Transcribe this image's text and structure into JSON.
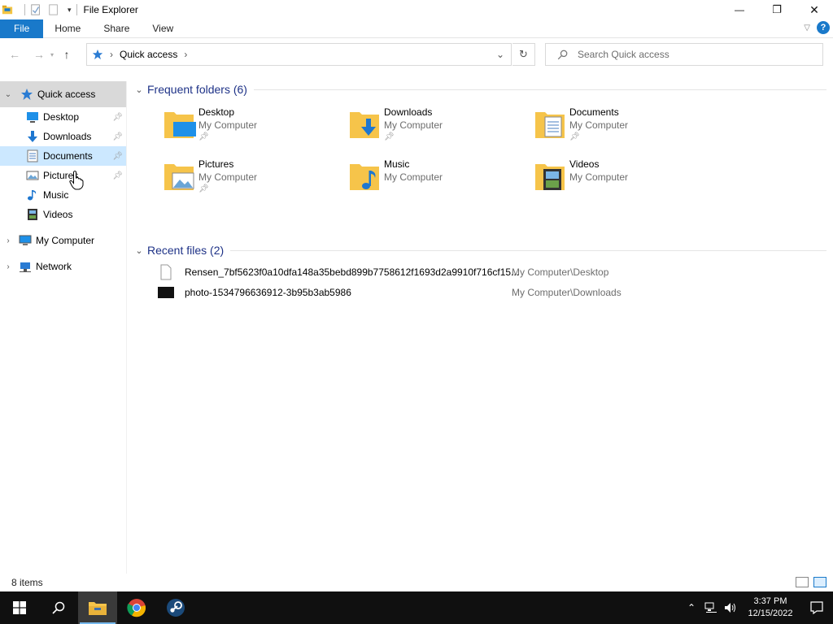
{
  "titlebar": {
    "title": "File Explorer",
    "minimize_glyph": "—",
    "maximize_glyph": "❐",
    "close_glyph": "✕"
  },
  "ribbon": {
    "tabs": [
      "File",
      "Home",
      "Share",
      "View"
    ],
    "help_label": "?"
  },
  "address": {
    "root_icon": "quick-access-star-icon",
    "crumb": "Quick access",
    "search_placeholder": "Search Quick access"
  },
  "navpane": {
    "quick_access": "Quick access",
    "pinned": [
      {
        "label": "Desktop",
        "icon": "desktop-icon",
        "pinned": true
      },
      {
        "label": "Downloads",
        "icon": "downloads-icon",
        "pinned": true
      },
      {
        "label": "Documents",
        "icon": "documents-icon",
        "pinned": true
      },
      {
        "label": "Pictures",
        "icon": "pictures-icon",
        "pinned": true
      },
      {
        "label": "Music",
        "icon": "music-icon",
        "pinned": false
      },
      {
        "label": "Videos",
        "icon": "videos-icon",
        "pinned": false
      }
    ],
    "my_computer": "My Computer",
    "network": "Network"
  },
  "frequent": {
    "header": "Frequent folders (6)",
    "items": [
      {
        "name": "Desktop",
        "location": "My Computer",
        "pinned": true
      },
      {
        "name": "Downloads",
        "location": "My Computer",
        "pinned": true
      },
      {
        "name": "Documents",
        "location": "My Computer",
        "pinned": true
      },
      {
        "name": "Pictures",
        "location": "My Computer",
        "pinned": true
      },
      {
        "name": "Music",
        "location": "My Computer",
        "pinned": false
      },
      {
        "name": "Videos",
        "location": "My Computer",
        "pinned": false
      }
    ]
  },
  "recent": {
    "header": "Recent files (2)",
    "items": [
      {
        "name": "Rensen_7bf5623f0a10dfa148a35bebd899b7758612f1693d2a9910f716cf15...",
        "location": "My Computer\\Desktop"
      },
      {
        "name": "photo-1534796636912-3b95b3ab5986",
        "location": "My Computer\\Downloads"
      }
    ]
  },
  "status": {
    "items_count": "8 items"
  },
  "taskbar": {
    "apps": [
      "start-button",
      "search-button",
      "file-explorer-app",
      "chrome-app",
      "steam-app"
    ],
    "time": "3:37 PM",
    "date": "12/15/2022"
  },
  "colors": {
    "accent": "#1979ca",
    "header_text": "#1e3287",
    "selection": "#cce8ff",
    "taskbar": "#101010"
  }
}
